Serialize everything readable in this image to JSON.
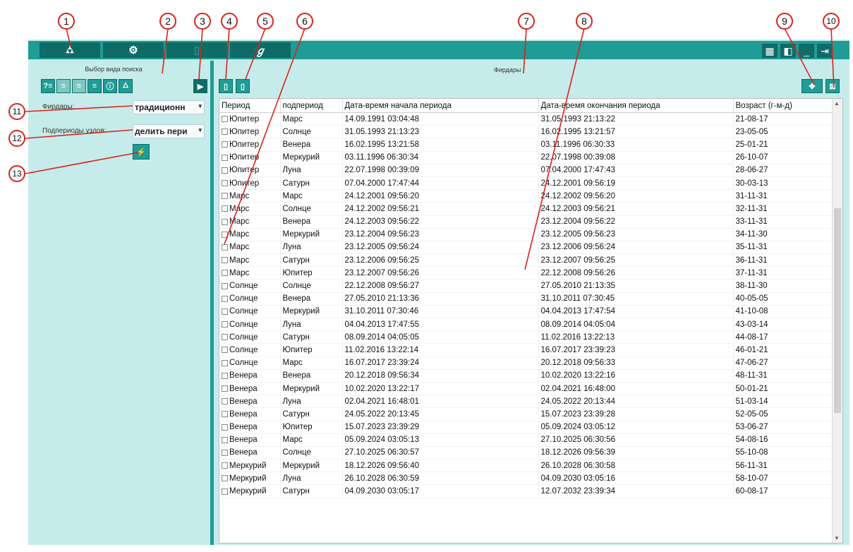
{
  "tabs": [
    {
      "icon": "binoculars-icon",
      "glyph": "⛼"
    },
    {
      "icon": "gear-icon",
      "glyph": "⚙"
    },
    {
      "icon": "book-icon",
      "glyph": "▯"
    },
    {
      "icon": "signature-icon",
      "glyph": "ℊ"
    }
  ],
  "window_buttons": [
    {
      "icon": "grid-icon",
      "glyph": "▦"
    },
    {
      "icon": "panel-icon",
      "glyph": "◧"
    },
    {
      "icon": "minimize-icon",
      "glyph": "_"
    },
    {
      "icon": "exit-icon",
      "glyph": "⇥"
    }
  ],
  "left_panel": {
    "caption": "Выбор вида поиска",
    "fields": [
      {
        "label": "Фирдары:",
        "value": "традиционн"
      },
      {
        "label": "Подпериоды узлов:",
        "value": "делить пери"
      }
    ]
  },
  "main": {
    "caption": "Фирдары",
    "columns": [
      "Период",
      "подпериод",
      "Дата-время начала периода",
      "Дата-время окончания периода",
      "Возраст (г-м-д)"
    ],
    "rows": [
      [
        "Юпитер",
        "Марс",
        "14.09.1991 03:04:48",
        "31.05.1993 21:13:22",
        "21-08-17"
      ],
      [
        "Юпитер",
        "Солнце",
        "31.05.1993 21:13:23",
        "16.02.1995 13:21:57",
        "23-05-05"
      ],
      [
        "Юпитер",
        "Венера",
        "16.02.1995 13:21:58",
        "03.11.1996 06:30:33",
        "25-01-21"
      ],
      [
        "Юпитер",
        "Меркурий",
        "03.11.1996 06:30:34",
        "22.07.1998 00:39:08",
        "26-10-07"
      ],
      [
        "Юпитер",
        "Луна",
        "22.07.1998 00:39:09",
        "07.04.2000 17:47:43",
        "28-06-27"
      ],
      [
        "Юпитер",
        "Сатурн",
        "07.04.2000 17:47:44",
        "24.12.2001 09:56:19",
        "30-03-13"
      ],
      [
        "Марс",
        "Марс",
        "24.12.2001 09:56:20",
        "24.12.2002 09:56:20",
        "31-11-31"
      ],
      [
        "Марс",
        "Солнце",
        "24.12.2002 09:56:21",
        "24.12.2003 09:56:21",
        "32-11-31"
      ],
      [
        "Марс",
        "Венера",
        "24.12.2003 09:56:22",
        "23.12.2004 09:56:22",
        "33-11-31"
      ],
      [
        "Марс",
        "Меркурий",
        "23.12.2004 09:56:23",
        "23.12.2005 09:56:23",
        "34-11-30"
      ],
      [
        "Марс",
        "Луна",
        "23.12.2005 09:56:24",
        "23.12.2006 09:56:24",
        "35-11-31"
      ],
      [
        "Марс",
        "Сатурн",
        "23.12.2006 09:56:25",
        "23.12.2007 09:56:25",
        "36-11-31"
      ],
      [
        "Марс",
        "Юпитер",
        "23.12.2007 09:56:26",
        "22.12.2008 09:56:26",
        "37-11-31"
      ],
      [
        "Солнце",
        "Солнце",
        "22.12.2008 09:56:27",
        "27.05.2010 21:13:35",
        "38-11-30"
      ],
      [
        "Солнце",
        "Венера",
        "27.05.2010 21:13:36",
        "31.10.2011 07:30:45",
        "40-05-05"
      ],
      [
        "Солнце",
        "Меркурий",
        "31.10.2011 07:30:46",
        "04.04.2013 17:47:54",
        "41-10-08"
      ],
      [
        "Солнце",
        "Луна",
        "04.04.2013 17:47:55",
        "08.09.2014 04:05:04",
        "43-03-14"
      ],
      [
        "Солнце",
        "Сатурн",
        "08.09.2014 04:05:05",
        "11.02.2016 13:22:13",
        "44-08-17"
      ],
      [
        "Солнце",
        "Юпитер",
        "11.02.2016 13:22:14",
        "16.07.2017 23:39:23",
        "46-01-21"
      ],
      [
        "Солнце",
        "Марс",
        "16.07.2017 23:39:24",
        "20.12.2018 09:56:33",
        "47-06-27"
      ],
      [
        "Венера",
        "Венера",
        "20.12.2018 09:56:34",
        "10.02.2020 13:22:16",
        "48-11-31"
      ],
      [
        "Венера",
        "Меркурий",
        "10.02.2020 13:22:17",
        "02.04.2021 16:48:00",
        "50-01-21"
      ],
      [
        "Венера",
        "Луна",
        "02.04.2021 16:48:01",
        "24.05.2022 20:13:44",
        "51-03-14"
      ],
      [
        "Венера",
        "Сатурн",
        "24.05.2022 20:13:45",
        "15.07.2023 23:39:28",
        "52-05-05"
      ],
      [
        "Венера",
        "Юпитер",
        "15.07.2023 23:39:29",
        "05.09.2024 03:05:12",
        "53-06-27"
      ],
      [
        "Венера",
        "Марс",
        "05.09.2024 03:05:13",
        "27.10.2025 06:30:56",
        "54-08-16"
      ],
      [
        "Венера",
        "Солнце",
        "27.10.2025 06:30:57",
        "18.12.2026 09:56:39",
        "55-10-08"
      ],
      [
        "Меркурий",
        "Меркурий",
        "18.12.2026 09:56:40",
        "26.10.2028 06:30:58",
        "56-11-31"
      ],
      [
        "Меркурий",
        "Луна",
        "26.10.2028 06:30:59",
        "04.09.2030 03:05:16",
        "58-10-07"
      ],
      [
        "Меркурий",
        "Сатурн",
        "04.09.2030 03:05:17",
        "12.07.2032 23:39:34",
        "60-08-17"
      ]
    ]
  },
  "callouts": [
    "1",
    "2",
    "3",
    "4",
    "5",
    "6",
    "7",
    "8",
    "9",
    "10",
    "11",
    "12",
    "13"
  ],
  "colors": {
    "accent": "#1f9c95",
    "accent_dark": "#0e6b66",
    "panel": "#c5ecea",
    "callout": "#d9231c"
  }
}
